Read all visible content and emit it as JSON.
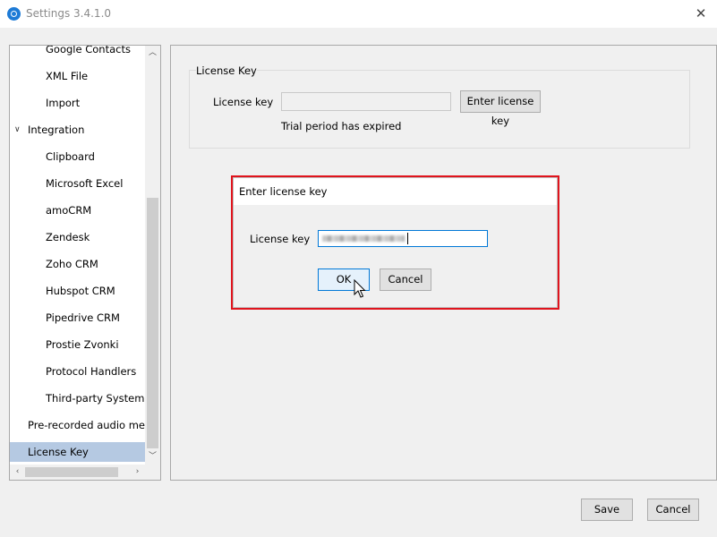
{
  "window": {
    "title": "Settings 3.4.1.0",
    "close_icon": "close-icon"
  },
  "sidebar": {
    "items": [
      {
        "label": "Google Contacts",
        "level": 2,
        "selected": false
      },
      {
        "label": "XML File",
        "level": 2,
        "selected": false
      },
      {
        "label": "Import",
        "level": 2,
        "selected": false
      },
      {
        "label": "Integration",
        "level": 1,
        "expanded": true,
        "selected": false
      },
      {
        "label": "Clipboard",
        "level": 2,
        "selected": false
      },
      {
        "label": "Microsoft Excel",
        "level": 2,
        "selected": false
      },
      {
        "label": "amoCRM",
        "level": 2,
        "selected": false
      },
      {
        "label": "Zendesk",
        "level": 2,
        "selected": false
      },
      {
        "label": "Zoho CRM",
        "level": 2,
        "selected": false
      },
      {
        "label": "Hubspot CRM",
        "level": 2,
        "selected": false
      },
      {
        "label": "Pipedrive CRM",
        "level": 2,
        "selected": false
      },
      {
        "label": "Prostie Zvonki",
        "level": 2,
        "selected": false
      },
      {
        "label": "Protocol Handlers",
        "level": 2,
        "selected": false
      },
      {
        "label": "Third-party Systems",
        "level": 2,
        "selected": false
      },
      {
        "label": "Pre-recorded audio messag",
        "level": 1,
        "selected": false
      },
      {
        "label": "License Key",
        "level": 1,
        "selected": true
      }
    ]
  },
  "license_panel": {
    "group_title": "License Key",
    "field_label": "License key",
    "field_value": "",
    "enter_button": "Enter license key",
    "status": "Trial period has expired"
  },
  "dialog": {
    "title": "Enter license key",
    "field_label": "License key",
    "field_value_obscured": true,
    "ok_label": "OK",
    "cancel_label": "Cancel",
    "highlight_color": "#e0141d"
  },
  "footer": {
    "save_label": "Save",
    "cancel_label": "Cancel"
  },
  "colors": {
    "selection": "#b5c9e2",
    "focus": "#0078d7",
    "app_icon": "#1e7bd6"
  }
}
